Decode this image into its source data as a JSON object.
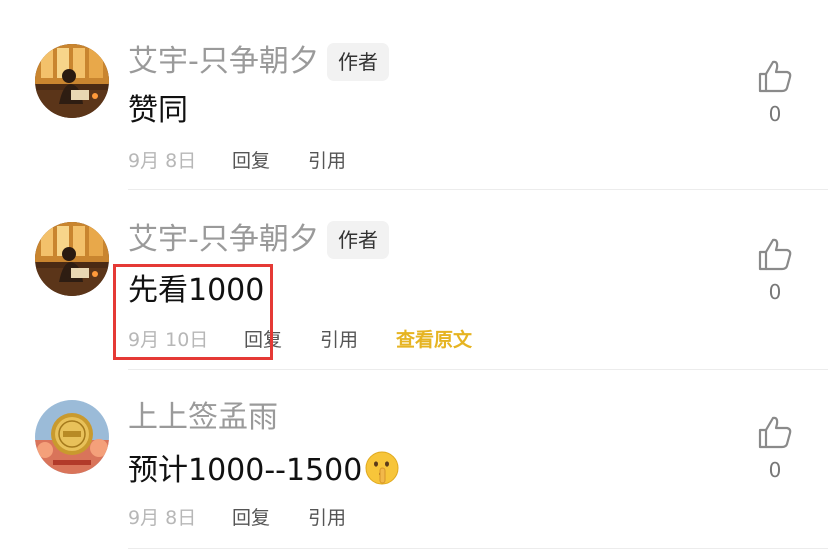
{
  "comments": [
    {
      "author": "艾宇-只争朝夕",
      "badge": "作者",
      "content": "赞同",
      "date": "9月 8日",
      "actions": [
        "回复",
        "引用"
      ],
      "likes": "0",
      "avatar_icon": "reading-person-avatar"
    },
    {
      "author": "艾宇-只争朝夕",
      "badge": "作者",
      "content": "先看1000",
      "date": "9月 10日",
      "actions": [
        "回复",
        "引用",
        "查看原文"
      ],
      "likes": "0",
      "avatar_icon": "reading-person-avatar",
      "highlighted": true
    },
    {
      "author": "上上签孟雨",
      "content": "预计1000--1500",
      "content_emoji": "shushing-face-emoji",
      "date": "9月 8日",
      "actions": [
        "回复",
        "引用"
      ],
      "likes": "0",
      "avatar_icon": "gold-coin-avatar"
    }
  ],
  "colors": {
    "author_name": "#9a9a9a",
    "date": "#b7b7b7",
    "action": "#555555",
    "view_original": "#e6b422",
    "highlight_box": "#e53935"
  }
}
